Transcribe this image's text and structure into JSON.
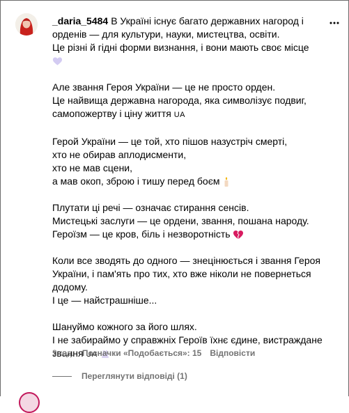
{
  "comment": {
    "username": "_daria_5484",
    "lines_p1": [
      "В Україні існує багато державних нагород і",
      "орденів — для культури, науки, мистецтва, освіти.",
      "Це різні й гідні форми визнання, і вони мають своє місце"
    ],
    "lines_p2": [
      "Але звання Героя України — це не просто орден.",
      "Це найвища державна нагорода, яка символізує подвиг,",
      "самопожертву і ціну життя"
    ],
    "lines_p3": [
      "Герой України — це той, хто пішов назустріч смерті,",
      "хто не обирав аплодисменти,",
      "хто не мав сцени,",
      "а мав окоп, зброю і тишу перед боєм"
    ],
    "lines_p4": [
      "Плутати ці речі — означає стирання сенсів.",
      "Мистецькі заслуги — це ордени, звання, пошана народу.",
      "Героїзм — це кров, біль і незворотність"
    ],
    "lines_p5": [
      "Коли все зводять до одного — знецінюється і звання Героя",
      "України, і пам'ять про тих, хто вже ніколи не повернеться",
      "додому.",
      "І це — найстрашніше..."
    ],
    "lines_p6": [
      "Шануймо кожного за його шлях.",
      "І не забираймо у справжніх Героїв їхнє єдине, вистраждане",
      "звання"
    ],
    "flag_text": "UA"
  },
  "meta": {
    "time": "3 год.",
    "likes": "Позначки «Подобається»: 15",
    "reply": "Відповісти"
  },
  "view_replies": "Переглянути відповіді (1)",
  "icons": {
    "more": "more-horizontal-icon",
    "purple_heart": "purple-heart-emoji",
    "candle": "candle-emoji",
    "broken_heart": "broken-heart-emoji",
    "hands": "hands-emoji"
  },
  "colors": {
    "meta_text": "#737373",
    "broken_heart": "#d81b60",
    "purple_heart": "#cfc6ef"
  }
}
